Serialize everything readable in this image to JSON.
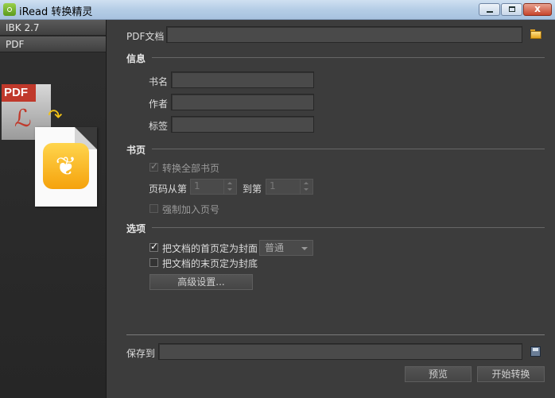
{
  "titlebar": {
    "app_name": "iRead",
    "title": "转换精灵",
    "close_symbol": "x"
  },
  "sidebar": {
    "items": [
      {
        "label": "IBK 2.7"
      },
      {
        "label": "PDF"
      }
    ],
    "illustration": {
      "pdf_badge": "PDF"
    }
  },
  "main": {
    "pdf_doc_label": "PDF文档",
    "pdf_doc_value": "",
    "info": {
      "heading": "信息",
      "title_label": "书名",
      "author_label": "作者",
      "tags_label": "标签"
    },
    "pages": {
      "heading": "书页",
      "convert_all_label": "转换全部书页",
      "range_from_label": "页码从第",
      "range_to_label": "到第",
      "from_value": "1",
      "to_value": "1",
      "force_page_number_label": "强制加入页号"
    },
    "options": {
      "heading": "选项",
      "first_as_cover_label": "把文档的首页定为封面",
      "cover_mode_selected": "普通",
      "last_as_back_label": "把文档的末页定为封底",
      "advanced_button": "高级设置..."
    },
    "save_to_label": "保存到",
    "save_to_value": "",
    "preview_button": "预览",
    "start_button": "开始转换"
  }
}
